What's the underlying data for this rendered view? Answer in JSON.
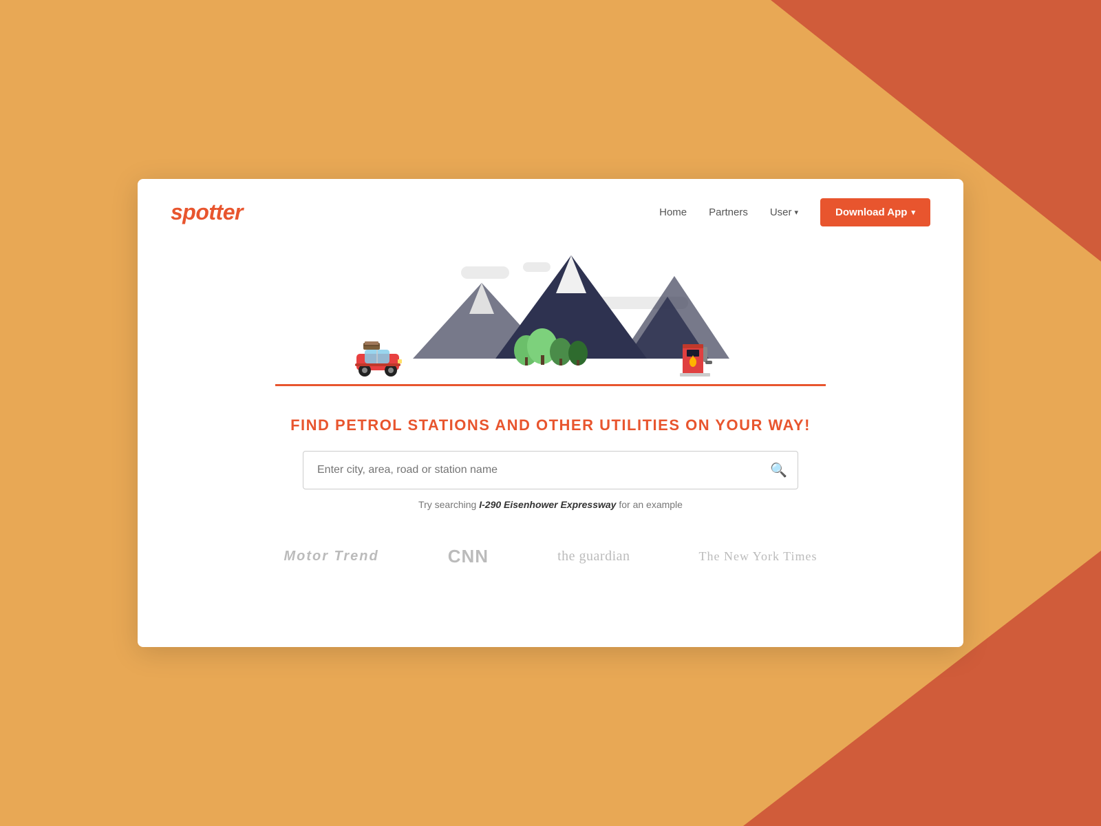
{
  "background": {
    "color": "#E8A855",
    "accent_color": "#D05C3A"
  },
  "navbar": {
    "logo": "spotter",
    "links": [
      {
        "label": "Home",
        "id": "home"
      },
      {
        "label": "Partners",
        "id": "partners"
      },
      {
        "label": "User",
        "id": "user",
        "has_dropdown": true
      }
    ],
    "cta_button": "Download App"
  },
  "hero": {
    "title": "FIND PETROL STATIONS AND OTHER UTILITIES ON YOUR WAY!",
    "search_placeholder": "Enter city, area, road or station name",
    "search_hint_prefix": "Try searching ",
    "search_hint_link": "I-290 Eisenhower Expressway",
    "search_hint_suffix": " for an example"
  },
  "media_logos": [
    {
      "name": "Motor Trend",
      "id": "motortrend"
    },
    {
      "name": "CNN",
      "id": "cnn"
    },
    {
      "name": "the guardian",
      "id": "guardian"
    },
    {
      "name": "The New York Times",
      "id": "nyt"
    }
  ]
}
